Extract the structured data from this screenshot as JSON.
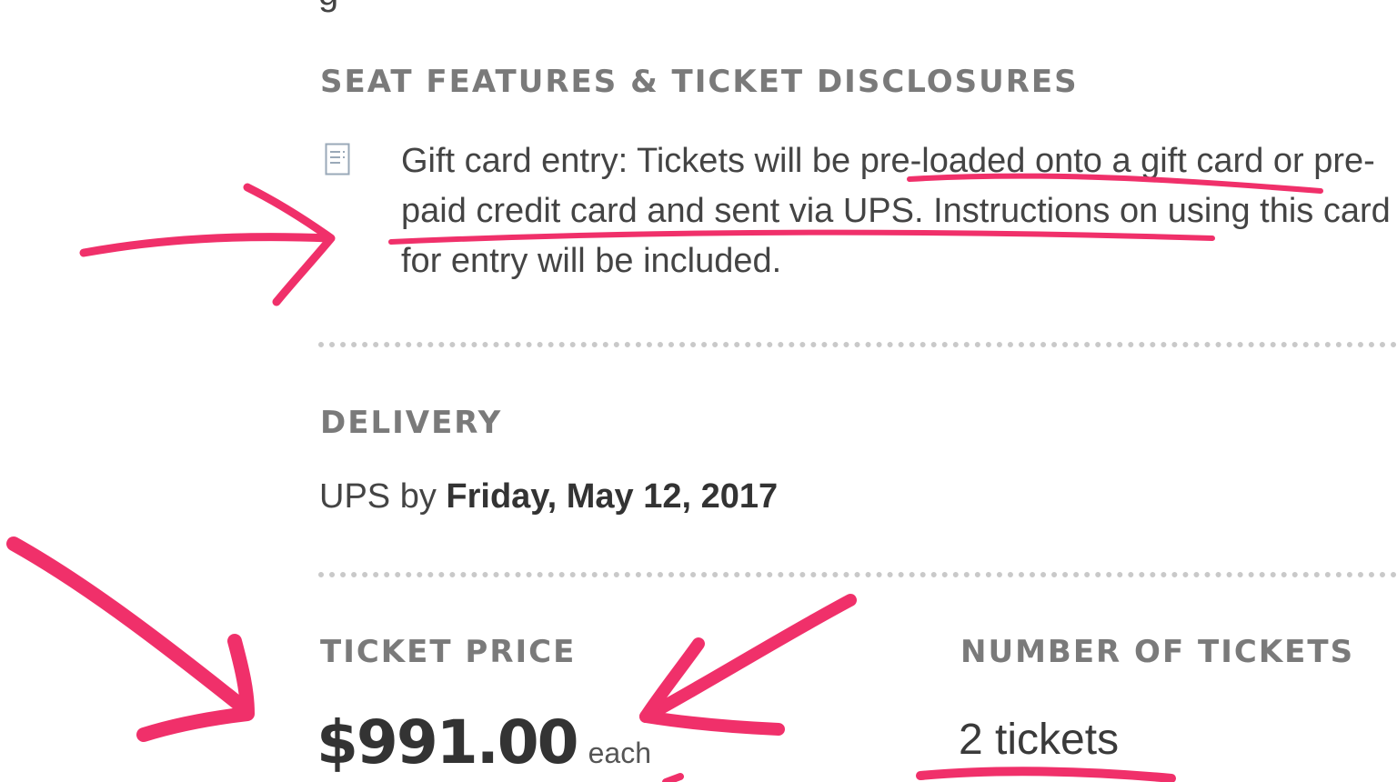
{
  "seat_features": {
    "heading": "SEAT FEATURES & TICKET DISCLOSURES",
    "icon": "receipt-icon",
    "disclosure_text": "Gift card entry: Tickets will be pre-loaded onto a gift card or pre-paid credit card and sent via UPS. Instructions on using this card for entry will be included."
  },
  "delivery": {
    "heading": "DELIVERY",
    "method": "UPS by",
    "date": "Friday, May 12, 2017"
  },
  "ticket_price": {
    "heading": "TICKET PRICE",
    "amount": "$991.00",
    "unit": "each"
  },
  "number_of_tickets": {
    "heading": "NUMBER OF TICKETS",
    "value": "2 tickets"
  },
  "colors": {
    "annotation": "#f0306a",
    "heading": "#7a7a7a",
    "divider": "#c9c9c9"
  }
}
